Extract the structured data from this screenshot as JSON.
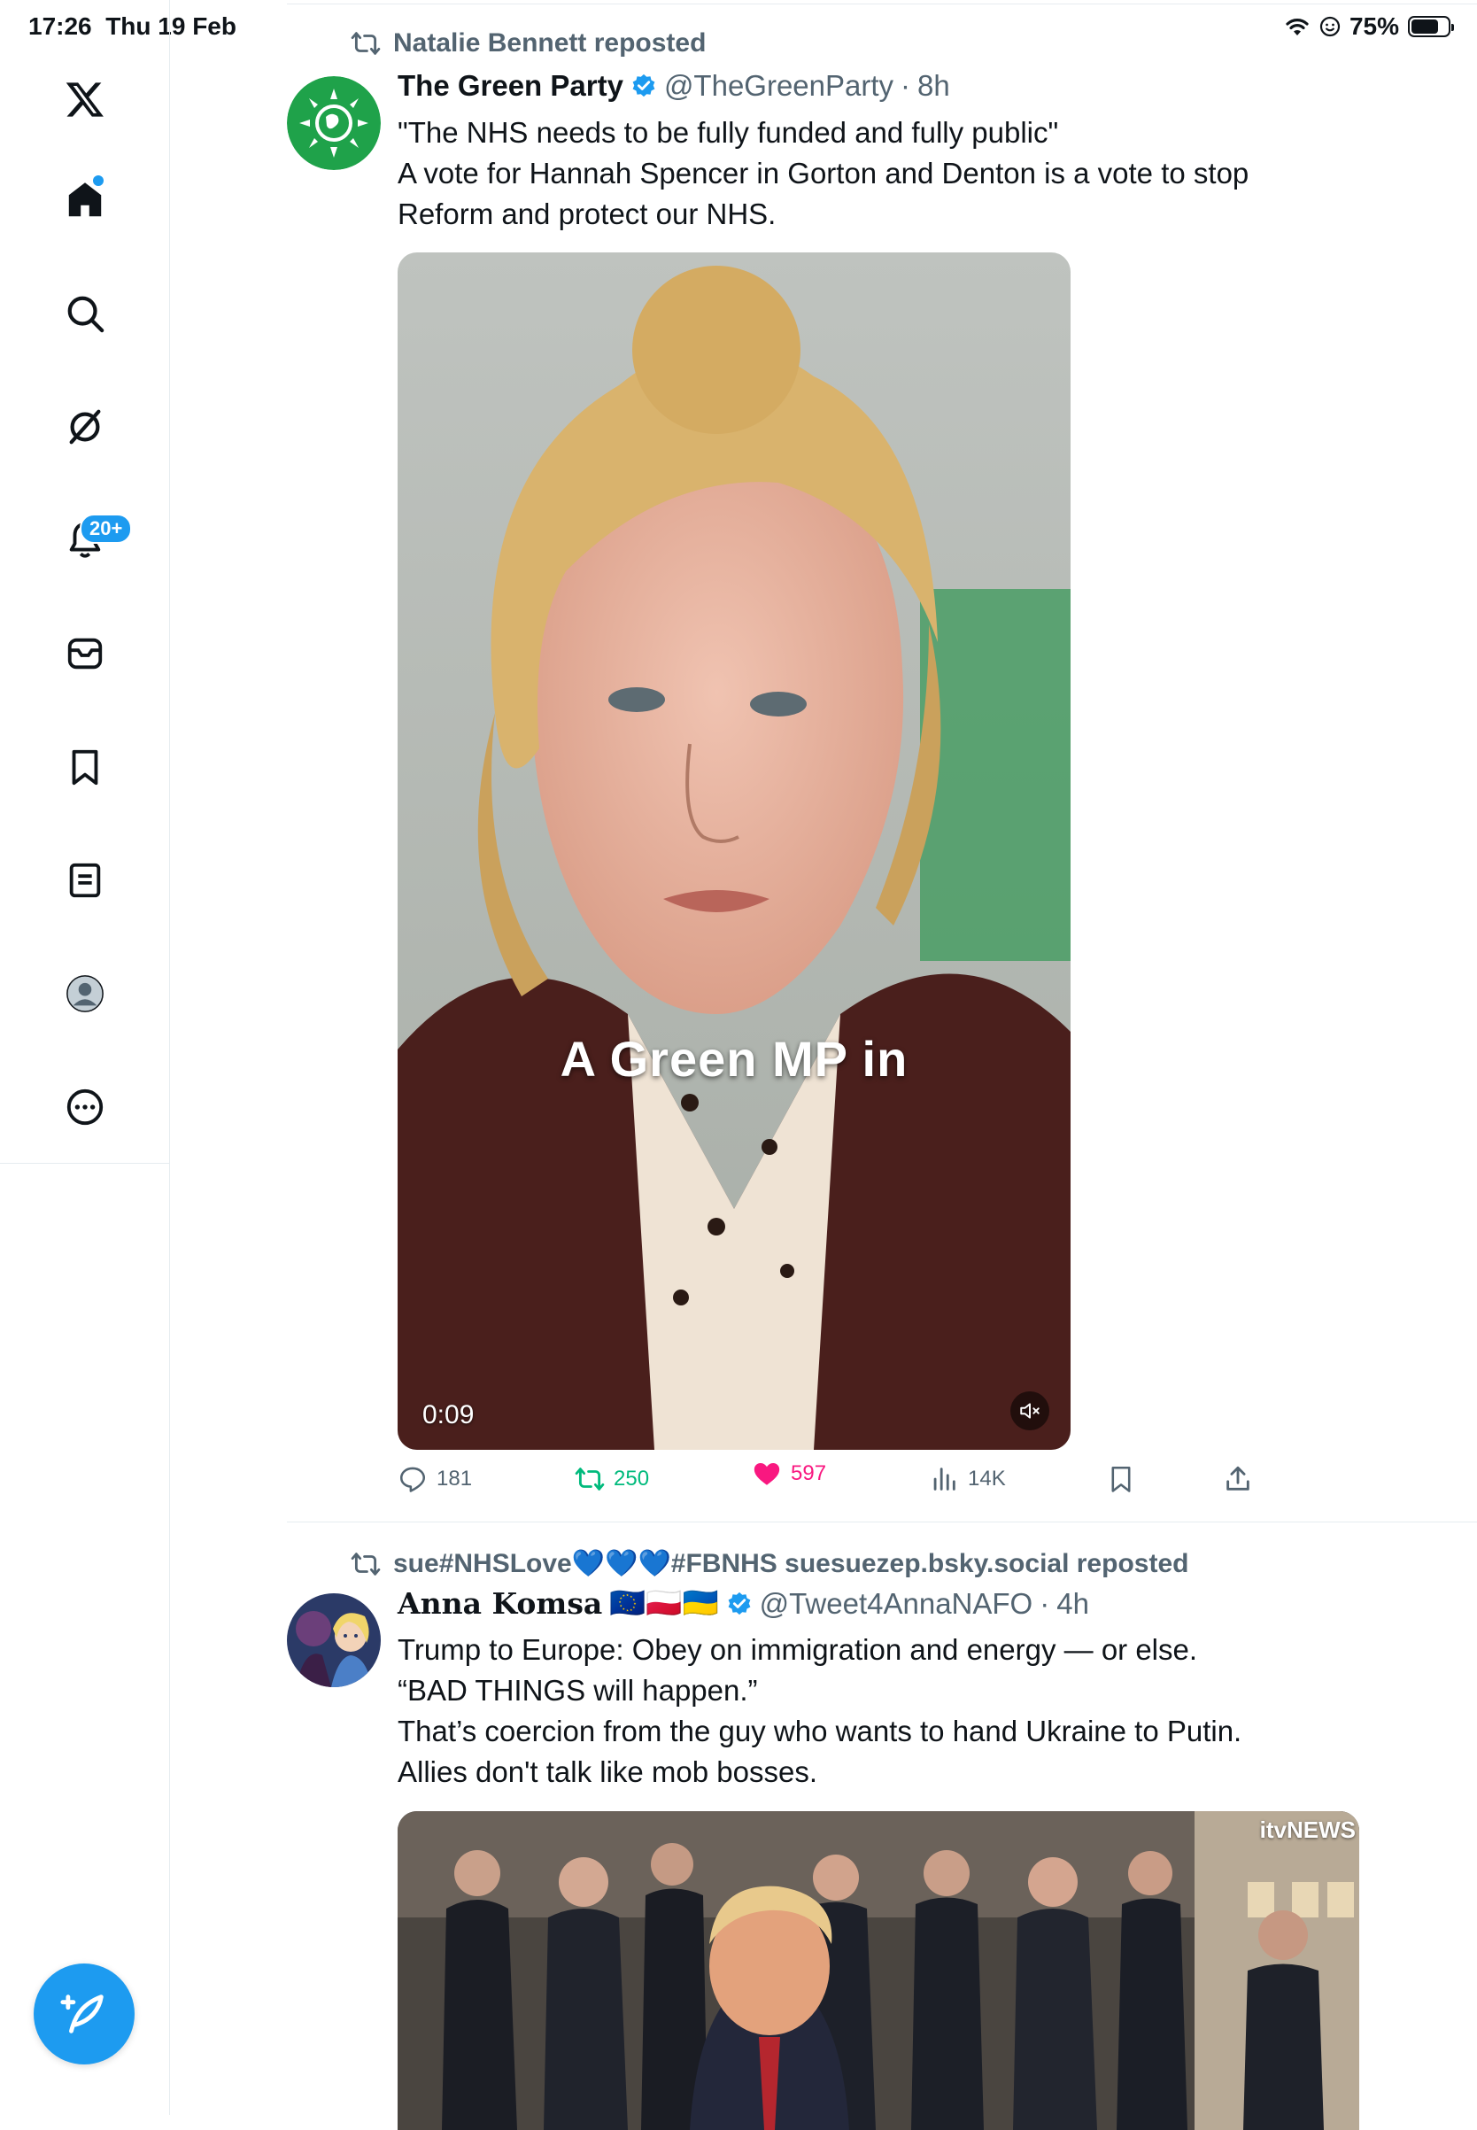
{
  "status_bar": {
    "time": "17:26",
    "date": "Thu 19 Feb",
    "battery": "75%",
    "battery_level": 0.75
  },
  "sidebar": {
    "items": [
      {
        "name": "x-logo"
      },
      {
        "name": "home"
      },
      {
        "name": "explore"
      },
      {
        "name": "grok"
      },
      {
        "name": "notifications",
        "badge": "20+"
      },
      {
        "name": "messages"
      },
      {
        "name": "bookmarks"
      },
      {
        "name": "lists"
      },
      {
        "name": "profile"
      },
      {
        "name": "more"
      }
    ],
    "compose_icon": "compose-feather-icon"
  },
  "colors": {
    "accent": "#1d9bf0",
    "muted": "#536471",
    "like": "#f91880",
    "repost": "#00ba7c"
  },
  "tweets": [
    {
      "repost_by": "Natalie Bennett reposted",
      "author": "The Green Party",
      "handle": "@TheGreenParty",
      "sep": "·",
      "time": "8h",
      "text": [
        "\"The NHS needs to be fully funded and fully public\"",
        "A vote for Hannah Spencer in Gorton and Denton is a vote to stop",
        "Reform and protect our NHS."
      ],
      "video": {
        "caption": "A Green MP in",
        "duration": "0:09"
      },
      "stats": {
        "replies": "181",
        "reposts": "250",
        "likes": "597",
        "views": "14K"
      }
    },
    {
      "repost_by": "sue#NHSLove💙💙💙#FBNHS suesuezep.bsky.social reposted",
      "author": "Anna Komsa",
      "flags": "🇪🇺🇵🇱🇺🇦",
      "handle": "@Tweet4AnnaNAFO",
      "sep": "·",
      "time": "4h",
      "text": [
        "Trump to Europe: Obey on immigration and energy — or else.",
        "“BAD THINGS will happen.”",
        "That’s coercion from the guy who wants to hand Ukraine to Putin.",
        "Allies don't talk like mob bosses."
      ],
      "video": {
        "watermark": "itvNEWS"
      }
    }
  ]
}
